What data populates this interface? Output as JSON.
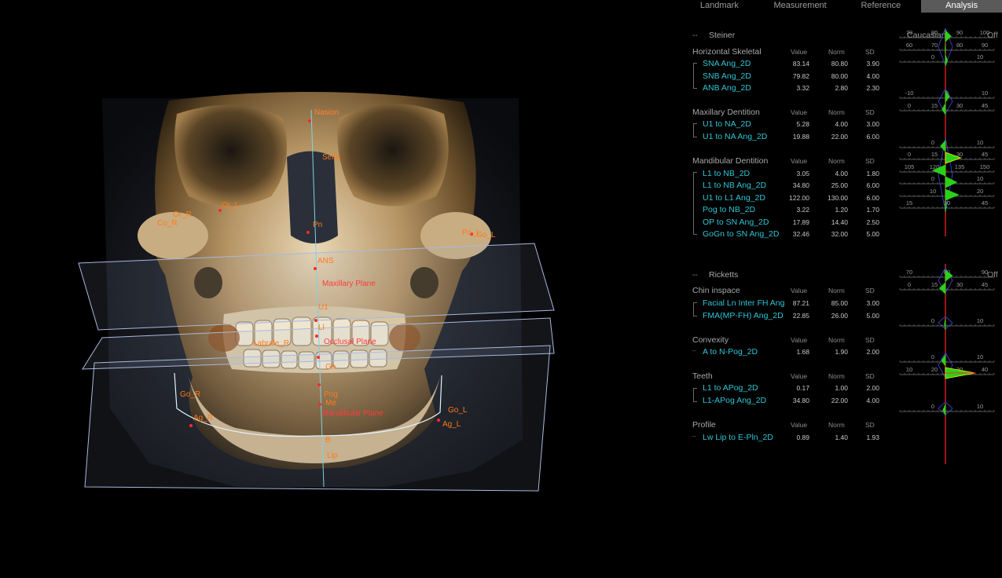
{
  "tabs": [
    "Landmark",
    "Measurement",
    "Reference",
    "Analysis"
  ],
  "active_tab": "Analysis",
  "column_headers": {
    "value": "Value",
    "norm": "Norm",
    "sd": "SD"
  },
  "collapse_symbol": "--",
  "steiner": {
    "title": "Steiner",
    "ethnicity": "Caucasian",
    "toggle": "Off",
    "groups": [
      {
        "name": "Horizontal Skeletal",
        "rows": [
          {
            "name": "SNA Ang_2D",
            "value": "83.14",
            "norm": "80.80",
            "sd": "3.90",
            "scale": [
              "70",
              "80",
              "90",
              "100"
            ]
          },
          {
            "name": "SNB Ang_2D",
            "value": "79.82",
            "norm": "80.00",
            "sd": "4.00",
            "scale": [
              "60",
              "70",
              "80",
              "90"
            ]
          },
          {
            "name": "ANB Ang_2D",
            "value": "3.32",
            "norm": "2.80",
            "sd": "2.30",
            "scale": [
              "0",
              "10"
            ]
          }
        ]
      },
      {
        "name": "Maxillary Dentition",
        "rows": [
          {
            "name": "U1 to NA_2D",
            "value": "5.28",
            "norm": "4.00",
            "sd": "3.00",
            "scale": [
              "-10",
              "0",
              "10"
            ]
          },
          {
            "name": "U1 to NA Ang_2D",
            "value": "19.88",
            "norm": "22.00",
            "sd": "6.00",
            "scale": [
              "0",
              "15",
              "30",
              "45"
            ]
          }
        ]
      },
      {
        "name": "Mandibular Dentition",
        "rows": [
          {
            "name": "L1 to NB_2D",
            "value": "3.05",
            "norm": "4.00",
            "sd": "1.80",
            "scale": [
              "0",
              "10"
            ]
          },
          {
            "name": "L1 to NB Ang_2D",
            "value": "34.80",
            "norm": "25.00",
            "sd": "6.00",
            "scale": [
              "0",
              "15",
              "30",
              "45"
            ]
          },
          {
            "name": "U1 to L1 Ang_2D",
            "value": "122.00",
            "norm": "130.00",
            "sd": "6.00",
            "scale": [
              "105",
              "120",
              "135",
              "150"
            ]
          },
          {
            "name": "Pog to NB_2D",
            "value": "3.22",
            "norm": "1.20",
            "sd": "1.70",
            "scale": [
              "0",
              "10"
            ]
          },
          {
            "name": "OP to SN Ang_2D",
            "value": "17.89",
            "norm": "14.40",
            "sd": "2.50",
            "scale": [
              "10",
              "20"
            ]
          },
          {
            "name": "GoGn to SN Ang_2D",
            "value": "32.46",
            "norm": "32.00",
            "sd": "5.00",
            "scale": [
              "15",
              "30",
              "45"
            ]
          }
        ]
      }
    ]
  },
  "ricketts": {
    "title": "Ricketts",
    "toggle": "Off",
    "groups": [
      {
        "name": "Chin inspace",
        "rows": [
          {
            "name": "Facial Ln Inter FH Ang",
            "value": "87.21",
            "norm": "85.00",
            "sd": "3.00",
            "scale": [
              "70",
              "80",
              "90"
            ]
          },
          {
            "name": "FMA(MP-FH) Ang_2D",
            "value": "22.85",
            "norm": "26.00",
            "sd": "5.00",
            "scale": [
              "0",
              "15",
              "30",
              "45"
            ]
          }
        ]
      },
      {
        "name": "Convexity",
        "rows": [
          {
            "name": "A to N-Pog_2D",
            "value": "1.68",
            "norm": "1.90",
            "sd": "2.00",
            "scale": [
              "0",
              "10"
            ]
          }
        ]
      },
      {
        "name": "Teeth",
        "rows": [
          {
            "name": "L1 to APog_2D",
            "value": "0.17",
            "norm": "1.00",
            "sd": "2.00",
            "scale": [
              "0",
              "10"
            ]
          },
          {
            "name": "L1-APog Ang_2D",
            "value": "34.80",
            "norm": "22.00",
            "sd": "4.00",
            "scale": [
              "10",
              "20",
              "30",
              "40"
            ]
          }
        ]
      },
      {
        "name": "Profile",
        "rows": [
          {
            "name": "Lw Lip to E-Pln_2D",
            "value": "0.89",
            "norm": "1.40",
            "sd": "1.93",
            "scale": [
              "0",
              "10"
            ]
          }
        ]
      }
    ]
  },
  "landmarks": [
    "Nasion",
    "Sella",
    "Or_R",
    "Or_L",
    "Po_L",
    "Go_L",
    "Co_R",
    "Pn",
    "ANS",
    "Maxillary Plane",
    "U1",
    "Occlusal Plane",
    "Ll",
    "Labrale_R",
    "Go_R",
    "Ag_R",
    "Go_L",
    "Ag_L",
    "Gn",
    "Mandibular Plane",
    "Pog",
    "Me",
    "B",
    "Lip"
  ],
  "colors": {
    "accent_cyan": "#2ec5d6",
    "landmark_orange": "#ff7a1a",
    "gauge_norm_line": "#e02020",
    "gauge_fill": "#29d11a",
    "gauge_hot": "#ffea00",
    "tab_active": "#5a5a5a"
  }
}
